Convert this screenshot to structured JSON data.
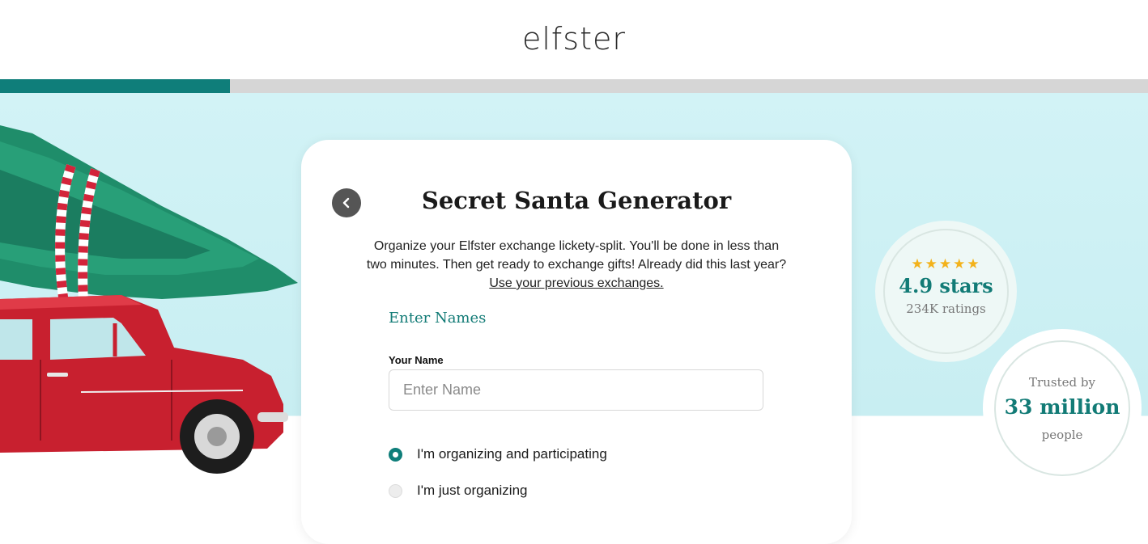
{
  "brand": {
    "logo_text": "elfster"
  },
  "progress": {
    "fraction": 0.2,
    "fill_color": "#0f7e7a",
    "track_color": "#d6d6d6"
  },
  "card": {
    "back_icon": "chevron-left-icon",
    "title": "Secret Santa Generator",
    "intro_text": "Organize your Elfster exchange lickety-split. You'll be done in less than two minutes. Then get ready to exchange gifts! Already did this last year?",
    "previous_link": "Use your previous exchanges.",
    "section_title": "Enter Names",
    "name_label": "Your Name",
    "name_value": "",
    "name_placeholder": "Enter Name",
    "options": [
      {
        "label": "I'm organizing and participating",
        "selected": true
      },
      {
        "label": "I'm just organizing",
        "selected": false
      }
    ]
  },
  "rating_badge": {
    "stars": "★★★★★",
    "rating": "4.9 stars",
    "count": "234K ratings"
  },
  "trusted_badge": {
    "top": "Trusted by",
    "big": "33 million",
    "bottom": "people"
  },
  "colors": {
    "accent": "#0f7e7a",
    "hero_bg": "#c8eef2",
    "star": "#f3b21b"
  }
}
